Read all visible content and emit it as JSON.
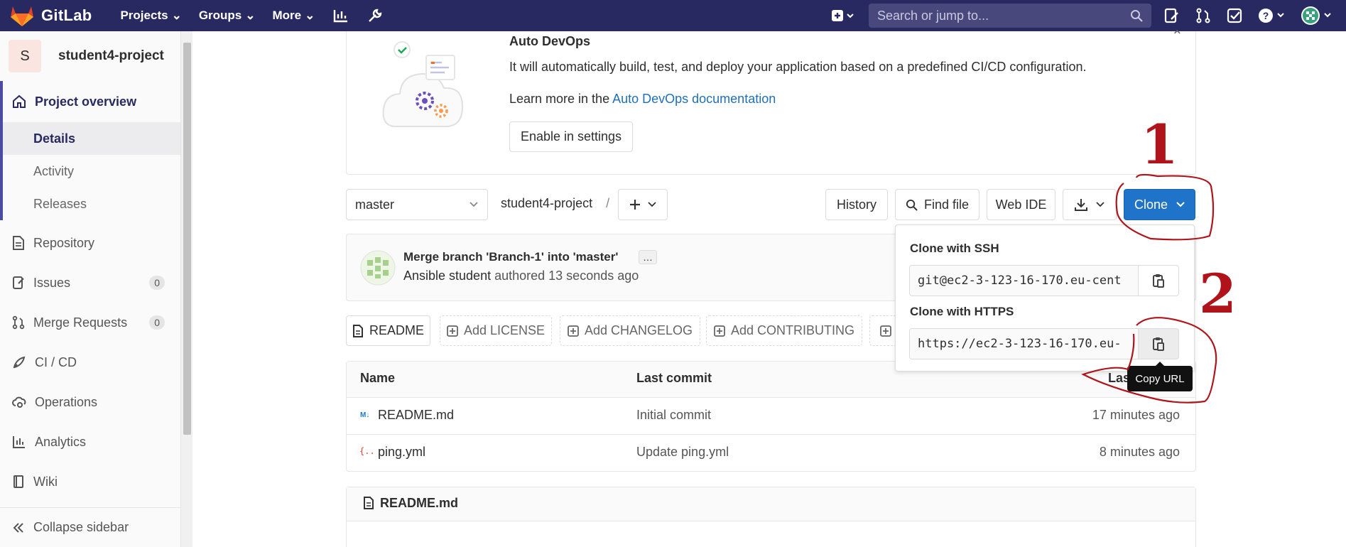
{
  "topbar": {
    "brand": "GitLab",
    "nav": [
      "Projects",
      "Groups",
      "More"
    ],
    "search_placeholder": "Search or jump to..."
  },
  "sidebar": {
    "project_initial": "S",
    "project_name": "student4-project",
    "overview": "Project overview",
    "sub_items": [
      "Details",
      "Activity",
      "Releases"
    ],
    "items": [
      {
        "label": "Repository",
        "icon": "doc-icon"
      },
      {
        "label": "Issues",
        "icon": "issues-icon",
        "count": "0"
      },
      {
        "label": "Merge Requests",
        "icon": "merge-request-icon",
        "count": "0"
      },
      {
        "label": "CI / CD",
        "icon": "rocket-icon"
      },
      {
        "label": "Operations",
        "icon": "cloud-gear-icon"
      },
      {
        "label": "Analytics",
        "icon": "chart-icon"
      },
      {
        "label": "Wiki",
        "icon": "book-icon"
      }
    ],
    "collapse": "Collapse sidebar"
  },
  "devops": {
    "title": "Auto DevOps",
    "text": "It will automatically build, test, and deploy your application based on a predefined CI/CD configuration.",
    "learn_prefix": "Learn more in the ",
    "learn_link": "Auto DevOps documentation",
    "button": "Enable in settings"
  },
  "toolbar": {
    "branch": "master",
    "path": "student4-project",
    "separator": "/",
    "history": "History",
    "find_file": "Find file",
    "web_ide": "Web IDE",
    "clone": "Clone"
  },
  "commit": {
    "title": "Merge branch 'Branch-1' into 'master'",
    "author": "Ansible student",
    "meta": " authored 13 seconds ago"
  },
  "file_buttons": [
    "README",
    "Add LICENSE",
    "Add CHANGELOG",
    "Add CONTRIBUTING"
  ],
  "table": {
    "headers": [
      "Name",
      "Last commit",
      "Last update"
    ],
    "rows": [
      {
        "name": "README.md",
        "commit": "Initial commit",
        "updated": "17 minutes ago"
      },
      {
        "name": "ping.yml",
        "commit": "Update ping.yml",
        "updated": "8 minutes ago"
      }
    ]
  },
  "readme_title": "README.md",
  "clone_dropdown": {
    "ssh_label": "Clone with SSH",
    "ssh_url": "git@ec2-3-123-16-170.eu-cent",
    "https_label": "Clone with HTTPS",
    "https_url": "https://ec2-3-123-16-170.eu-",
    "tooltip": "Copy URL"
  },
  "annotations": {
    "one": "1",
    "two": "2",
    "color": "#b0141a"
  },
  "colors": {
    "nav_bg": "#292961",
    "primary": "#1f73c9",
    "link": "#1f6fbd"
  }
}
